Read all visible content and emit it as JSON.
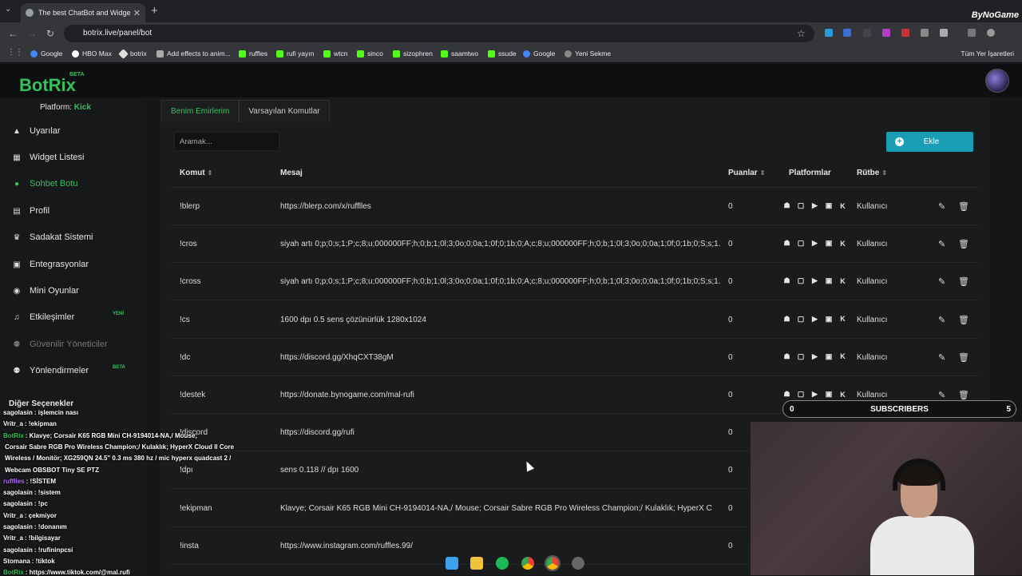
{
  "browser": {
    "tab_title": "The best ChatBot and Widgets",
    "url": "botrix.live/panel/bot",
    "corner_brand": "ByNoGame",
    "bookmarks": [
      "Google",
      "HBO Max",
      "botrix",
      "Add effects to anim...",
      "ruffles",
      "rufi yayın",
      "wtcn",
      "sinco",
      "sizophren",
      "saamtwo",
      "ssude",
      "Google",
      "Yeni Sekme"
    ],
    "bookmarks_right": "Tüm Yer İşaretleri"
  },
  "app": {
    "logo": "BotRix",
    "beta": "BETA",
    "platform_label": "Platform:",
    "platform_value": "Kick",
    "sidebar": [
      {
        "label": "Uyarılar",
        "icon": "warning-icon"
      },
      {
        "label": "Widget Listesi",
        "icon": "grid-icon"
      },
      {
        "label": "Sohbet Botu",
        "icon": "robot-icon"
      },
      {
        "label": "Profil",
        "icon": "id-card-icon"
      },
      {
        "label": "Sadakat Sistemi",
        "icon": "trophy-icon"
      },
      {
        "label": "Entegrasyonlar",
        "icon": "plug-icon"
      },
      {
        "label": "Mini Oyunlar",
        "icon": "gamepad-icon"
      },
      {
        "label": "Etkileşimler",
        "icon": "music-icon"
      },
      {
        "label": "Güvenilir Yöneticiler",
        "icon": "users-icon"
      },
      {
        "label": "Yönlendirmeler",
        "icon": "users-icon"
      }
    ],
    "badge_new": "YENİ",
    "badge_beta": "BETA",
    "other_options": "Diğer Seçenekler"
  },
  "content": {
    "tabs": [
      "Benim Emirlerim",
      "Varsayılan Komutlar"
    ],
    "search_placeholder": "Aramak...",
    "add_button": "Ekle",
    "headers": {
      "command": "Komut",
      "message": "Mesaj",
      "points": "Puanlar",
      "platforms": "Platformlar",
      "rank": "Rütbe"
    },
    "rows": [
      {
        "cmd": "!blerp",
        "msg": "https://blerp.com/x/rufflles",
        "pts": "0",
        "rank": "Kullanıcı"
      },
      {
        "cmd": "!cros",
        "msg": "siyah artı 0;p;0;s;1;P;c;8;u;000000FF;h;0;b;1;0l;3;0o;0;0a;1;0f;0;1b;0;A;c;8;u;000000FF;h;0;b;1;0l;3;0o;0;0a;1;0f;0;1b;0;S;s;1.1",
        "pts": "0",
        "rank": "Kullanıcı"
      },
      {
        "cmd": "!cross",
        "msg": "siyah artı 0;p;0;s;1;P;c;8;u;000000FF;h;0;b;1;0l;3;0o;0;0a;1;0f;0;1b;0;A;c;8;u;000000FF;h;0;b;1;0l;3;0o;0;0a;1;0f;0;1b;0;S;s;1.1",
        "pts": "0",
        "rank": "Kullanıcı"
      },
      {
        "cmd": "!cs",
        "msg": "1600 dpı 0.5 sens çözünürlük 1280x1024",
        "pts": "0",
        "rank": "Kullanıcı"
      },
      {
        "cmd": "!dc",
        "msg": "https://discord.gg/XhqCXT38gM",
        "pts": "0",
        "rank": "Kullanıcı"
      },
      {
        "cmd": "!destek",
        "msg": "https://donate.bynogame.com/mal-rufi",
        "pts": "0",
        "rank": "Kullanıcı"
      },
      {
        "cmd": "!discord",
        "msg": "https://discord.gg/rufi",
        "pts": "0",
        "rank": ""
      },
      {
        "cmd": "!dpı",
        "msg": "sens 0.118 // dpı 1600",
        "pts": "0",
        "rank": ""
      },
      {
        "cmd": "!ekipman",
        "msg": "Klavye; Corsair K65 RGB Mini CH-9194014-NA,/ Mouse; Corsair Sabre RGB Pro Wireless Champion;/ Kulaklık; HyperX C",
        "pts": "0",
        "rank": ""
      },
      {
        "cmd": "!insta",
        "msg": "https://www.instagram.com/ruffles.99/",
        "pts": "0",
        "rank": ""
      }
    ]
  },
  "overlay": {
    "subs_current": "0",
    "subs_label": "SUBSCRIBERS",
    "subs_goal": "5",
    "chat": [
      {
        "user": "sagolasin",
        "color": "#ffffff",
        "text": ": işlemcin nası"
      },
      {
        "user": "Vritr_a",
        "color": "#ffffff",
        "text": ": !ekipman"
      },
      {
        "user": "BotRix",
        "color": "#35c15b",
        "text": ": Klavye; Corsair K65 RGB Mini CH-9194014-NA,/ Mouse;"
      },
      {
        "user": "",
        "color": "#ffffff",
        "text": "Corsair Sabre RGB Pro Wireless Champion;/ Kulaklık; HyperX Cloud II Core"
      },
      {
        "user": "",
        "color": "#ffffff",
        "text": "Wireless / Monitör; XG259QN 24.5\" 0.3 ms 380 hz / mic hyperx quadcast 2 /"
      },
      {
        "user": "",
        "color": "#ffffff",
        "text": "Webcam OBSBOT Tiny SE PTZ"
      },
      {
        "user": "rufflles",
        "color": "#b36bff",
        "text": ": !SİSTEM"
      },
      {
        "user": "sagolasin",
        "color": "#ffffff",
        "text": ": !sistem"
      },
      {
        "user": "sagolasin",
        "color": "#ffffff",
        "text": ": !pc"
      },
      {
        "user": "Vritr_a",
        "color": "#ffffff",
        "text": ": çekmiyor"
      },
      {
        "user": "sagolasin",
        "color": "#ffffff",
        "text": ": !donanım"
      },
      {
        "user": "Vritr_a",
        "color": "#ffffff",
        "text": ": !bilgisayar"
      },
      {
        "user": "sagolasin",
        "color": "#ffffff",
        "text": ": !rufininpcsi"
      },
      {
        "user": "Stomana",
        "color": "#ffffff",
        "text": ": !tiktok"
      },
      {
        "user": "BotRix",
        "color": "#35c15b",
        "text": ": https://www.tiktok.com/@mal.rufi"
      }
    ]
  }
}
